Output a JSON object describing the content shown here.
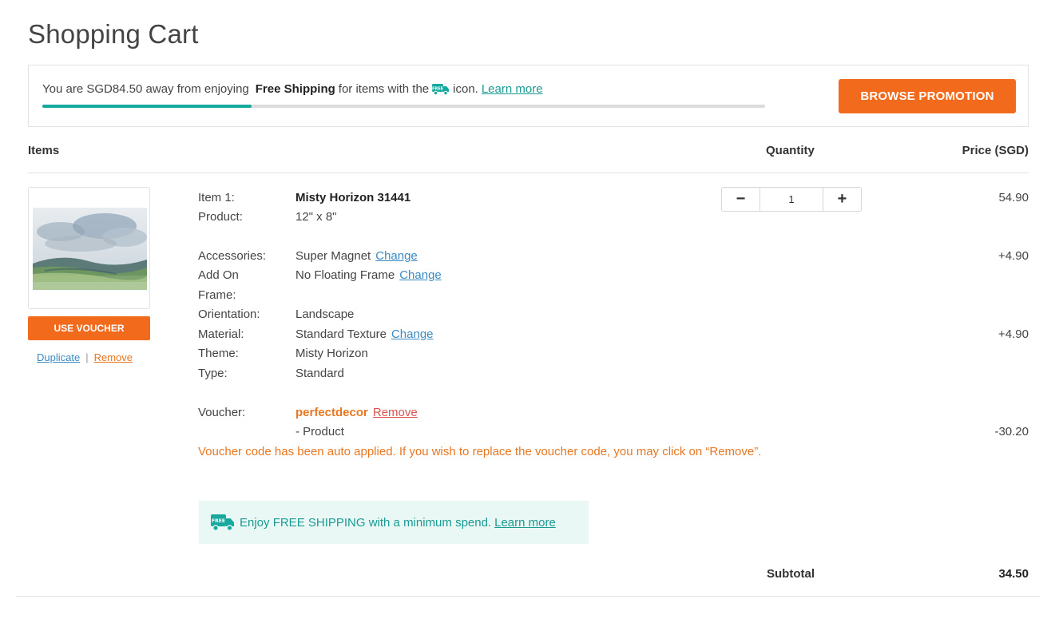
{
  "page": {
    "title": "Shopping Cart"
  },
  "shipping_banner": {
    "text_before": "You are SGD84.50 away from enjoying",
    "text_bold": "Free Shipping",
    "text_middle": "for items with the",
    "text_after": "icon.",
    "learn_more": "Learn more",
    "progress_percent": 29,
    "button_label": "BROWSE PROMOTION"
  },
  "table_headers": {
    "items": "Items",
    "quantity": "Quantity",
    "price": "Price (SGD)"
  },
  "item": {
    "image_icon": "landscape-painting-image",
    "use_voucher_label": "USE VOUCHER",
    "duplicate_label": "Duplicate",
    "separator": "|",
    "remove_label": "Remove",
    "item_label": "Item 1:",
    "item_name": "Misty Horizon 31441",
    "product_label": "Product:",
    "product_value": "12\" x 8\"",
    "accessories_label": "Accessories:",
    "accessories_value": "Super Magnet",
    "change_label": "Change",
    "addon_label": "Add On",
    "addon_value": "No Floating Frame",
    "frame_label": "Frame:",
    "orientation_label": "Orientation:",
    "orientation_value": "Landscape",
    "material_label": "Material:",
    "material_value": "Standard Texture",
    "theme_label": "Theme:",
    "theme_value": "Misty Horizon",
    "type_label": "Type:",
    "type_value": "Standard",
    "voucher_label": "Voucher:",
    "voucher_code": "perfectdecor",
    "voucher_remove": "Remove",
    "voucher_scope": "- Product",
    "voucher_note": "Voucher code has been auto applied. If you wish to replace the voucher code, you may click on “Remove”.",
    "quantity": "1",
    "minus_symbol": "−",
    "plus_symbol": "+",
    "price_base": "54.90",
    "price_accessories": "+4.90",
    "price_material": "+4.90",
    "price_voucher": "-30.20"
  },
  "free_shipping_notice": {
    "text": "Enjoy FREE SHIPPING with a minimum spend.",
    "learn_more": "Learn more",
    "icon_badge": "FREE"
  },
  "subtotal": {
    "label": "Subtotal",
    "value": "34.50"
  },
  "colors": {
    "accent_orange": "#f26b1d",
    "teal": "#17a89e",
    "link_blue": "#3a8ac4",
    "remove_red": "#d9534f"
  }
}
